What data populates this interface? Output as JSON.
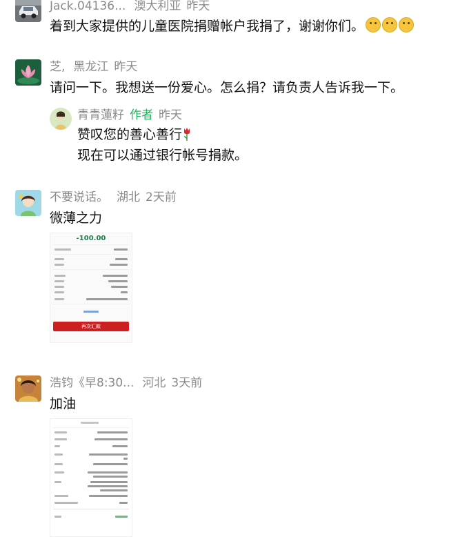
{
  "comments": [
    {
      "username": "Jack.04136...",
      "location": "澳大利亚",
      "time": "昨天",
      "text": "着到大家提供的儿童医院捐赠帐户我捐了，谢谢你们。",
      "emoji": "smiling-face-emoji"
    },
    {
      "username": "芝,",
      "location": "黑龙江",
      "time": "昨天",
      "text": "请问一下。我想送一份爱心。怎么捐？请负责人告诉我一下。",
      "reply": {
        "username": "青青蓮籽",
        "author_tag": "作者",
        "time": "昨天",
        "line1": "赞叹您的善心善行",
        "line2": "现在可以通过银行帐号捐款。"
      }
    },
    {
      "username": "不要说话。",
      "location": "湖北",
      "time": "2天前",
      "text": "微薄之力",
      "receipt": {
        "amount": "-100.00",
        "button": "再次汇款"
      }
    },
    {
      "username": "浩钧《早8:30...",
      "location": "河北",
      "time": "3天前",
      "text": "加油"
    }
  ],
  "colors": {
    "author_tag": "#1fb35a",
    "meta": "#8a8a8a",
    "receipt_button": "#cc1f1f",
    "receipt_amount": "#1a7f4b"
  }
}
